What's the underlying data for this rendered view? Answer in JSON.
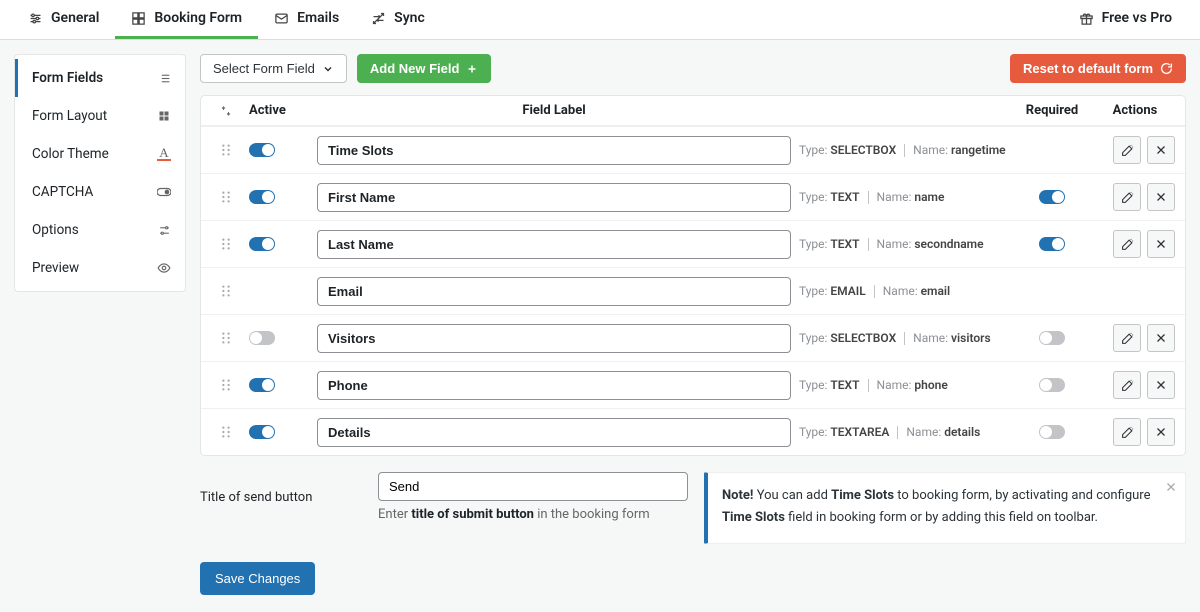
{
  "tabs": {
    "general": "General",
    "booking": "Booking Form",
    "emails": "Emails",
    "sync": "Sync",
    "free_pro": "Free vs Pro"
  },
  "sidebar": {
    "items": [
      {
        "label": "Form Fields",
        "icon": "list"
      },
      {
        "label": "Form Layout",
        "icon": "grid"
      },
      {
        "label": "Color Theme",
        "icon": "text-a"
      },
      {
        "label": "CAPTCHA",
        "icon": "toggle"
      },
      {
        "label": "Options",
        "icon": "sliders"
      },
      {
        "label": "Preview",
        "icon": "eye"
      }
    ]
  },
  "toolbar": {
    "select_field": "Select Form Field",
    "add_new": "Add New Field",
    "reset": "Reset to default form"
  },
  "table": {
    "headers": {
      "active": "Active",
      "label": "Field Label",
      "required": "Required",
      "actions": "Actions"
    },
    "type_prefix": "Type:",
    "name_prefix": "Name:",
    "rows": [
      {
        "active": true,
        "label": "Time Slots",
        "type": "SELECTBOX",
        "name": "rangetime",
        "required": null,
        "has_actions": true
      },
      {
        "active": true,
        "label": "First Name",
        "type": "TEXT",
        "name": "name",
        "required": true,
        "has_actions": true
      },
      {
        "active": true,
        "label": "Last Name",
        "type": "TEXT",
        "name": "secondname",
        "required": true,
        "has_actions": true
      },
      {
        "active": null,
        "label": "Email",
        "type": "EMAIL",
        "name": "email",
        "required": null,
        "has_actions": false
      },
      {
        "active": false,
        "label": "Visitors",
        "type": "SELECTBOX",
        "name": "visitors",
        "required": false,
        "has_actions": true
      },
      {
        "active": true,
        "label": "Phone",
        "type": "TEXT",
        "name": "phone",
        "required": false,
        "has_actions": true
      },
      {
        "active": true,
        "label": "Details",
        "type": "TEXTAREA",
        "name": "details",
        "required": false,
        "has_actions": true
      }
    ]
  },
  "send_title": {
    "label": "Title of send button",
    "value": "Send",
    "hint_pre": "Enter",
    "hint_bold": "title of submit button",
    "hint_post": "in the booking form"
  },
  "note": {
    "bold1": "Note!",
    "t1": "You can add",
    "bold2": "Time Slots",
    "t2": "to booking form, by activating and configure",
    "bold3": "Time Slots",
    "t3": "field in booking form or by adding this field on toolbar."
  },
  "save": "Save Changes"
}
